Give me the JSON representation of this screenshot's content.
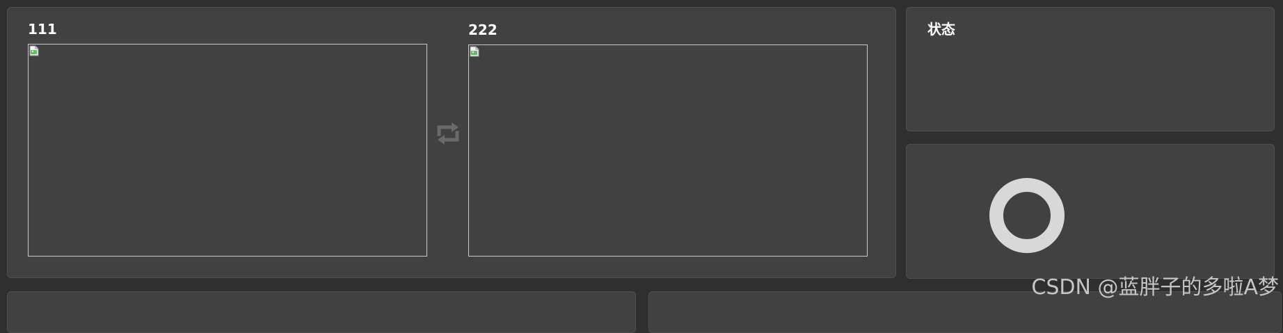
{
  "compare": {
    "left_label": "111",
    "right_label": "222",
    "swap_icon": "swap-arrows-icon",
    "image_placeholder_icon": "broken-image-icon"
  },
  "status": {
    "title": "状态"
  },
  "loading": {
    "icon": "loading-ring-icon"
  },
  "watermark": "CSDN @蓝胖子的多啦A梦",
  "colors": {
    "page_background": "#2f2f2f",
    "panel_background": "#414141",
    "panel_border": "#4f4f4f",
    "frame_border": "#c9c9c9",
    "swap_icon": "#6a6a6a",
    "spinner": "#d8d8d8"
  }
}
